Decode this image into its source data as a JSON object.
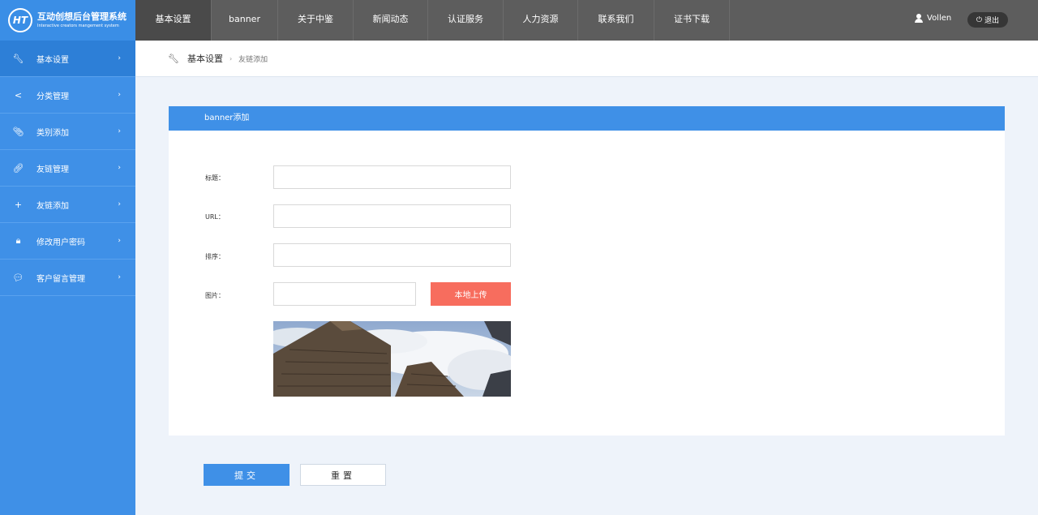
{
  "app": {
    "logo_mark": "HT",
    "title_cn": "互动创想后台管理系统",
    "title_en": "Interactive creators mangement system"
  },
  "nav": [
    {
      "label": "基本设置",
      "active": true
    },
    {
      "label": "banner"
    },
    {
      "label": "关于中鉴"
    },
    {
      "label": "新闻动态"
    },
    {
      "label": "认证服务"
    },
    {
      "label": "人力资源"
    },
    {
      "label": "联系我们"
    },
    {
      "label": "证书下载"
    }
  ],
  "user": {
    "name": "Vollen",
    "logout_label": "退出"
  },
  "sidebar": {
    "items": [
      {
        "label": "基本设置",
        "icon": "wrench-icon",
        "active": true
      },
      {
        "label": "分类管理",
        "icon": "share-icon"
      },
      {
        "label": "类别添加",
        "icon": "paperclip-icon"
      },
      {
        "label": "友链管理",
        "icon": "link-icon"
      },
      {
        "label": "友链添加",
        "icon": "plus-icon"
      },
      {
        "label": "修改用户密码",
        "icon": "lock-icon"
      },
      {
        "label": "客户留言管理",
        "icon": "comment-icon"
      }
    ]
  },
  "breadcrumb": {
    "main": "基本设置",
    "sub": "友链添加"
  },
  "panel": {
    "title": "banner添加"
  },
  "form": {
    "title_label": "标题：",
    "url_label": "URL：",
    "order_label": "排序：",
    "image_label": "图片：",
    "title_value": "",
    "url_value": "",
    "order_value": "",
    "image_value": "",
    "upload_label": "本地上传"
  },
  "actions": {
    "submit_label": "提交",
    "reset_label": "重置"
  },
  "colors": {
    "accent": "#3f90e7",
    "upload": "#f76d5e",
    "topbar": "#5d5d5d"
  }
}
